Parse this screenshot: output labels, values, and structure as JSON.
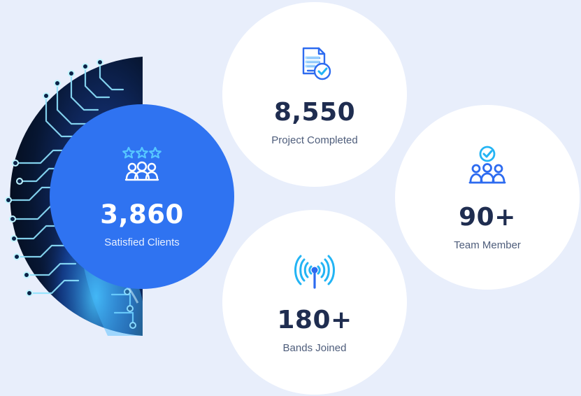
{
  "colors": {
    "background": "#e8eefb",
    "primary_blue": "#2f73f1",
    "dark_text": "#1f2d50",
    "muted_text": "#4e5d7b",
    "accent_cyan": "#23b4f4",
    "accent_blue": "#2d6bf0"
  },
  "stats": {
    "clients": {
      "value": "3,860",
      "label": "Satisfied Clients",
      "icon": "users-rating-icon"
    },
    "projects": {
      "value": "8,550",
      "label": "Project Completed",
      "icon": "project-check-icon"
    },
    "team": {
      "value": "90+",
      "label": "Team Member",
      "icon": "team-check-icon"
    },
    "bands": {
      "value": "180+",
      "label": "Bands Joined",
      "icon": "signal-tower-icon"
    }
  }
}
